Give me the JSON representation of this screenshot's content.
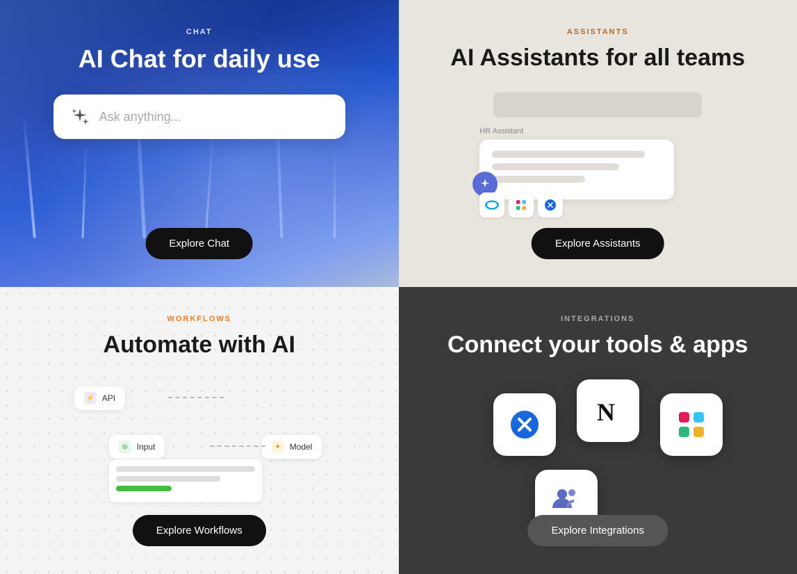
{
  "chat": {
    "label": "CHAT",
    "title": "AI Chat for daily use",
    "placeholder": "Ask anything...",
    "button": "Explore Chat"
  },
  "assistants": {
    "label": "ASSISTANTS",
    "title": "AI Assistants for all teams",
    "hr_label": "HR Assistant",
    "button": "Explore Assistants"
  },
  "workflows": {
    "label": "WORKFLOWS",
    "title": "Automate with AI",
    "node_api": "API",
    "node_input": "Input",
    "node_model": "Model",
    "button": "Explore Workflows"
  },
  "integrations": {
    "label": "INTEGRATIONS",
    "title": "Connect your tools & apps",
    "button": "Explore Integrations"
  }
}
